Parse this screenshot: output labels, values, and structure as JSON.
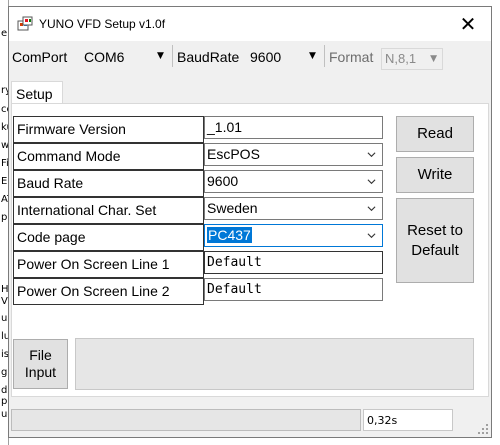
{
  "background_app": {
    "fragments": [
      "e",
      "ry",
      "co",
      "ku",
      "wr",
      "Fi",
      "E",
      "AT",
      "pr",
      "H",
      "V",
      "ul",
      "lu",
      "is",
      "g",
      "du",
      "pi",
      "ud"
    ]
  },
  "window": {
    "title": "YUNO VFD Setup v1.0f",
    "close_glyph": "✕"
  },
  "toolbar": {
    "comport_label": "ComPort",
    "comport_value": "COM6",
    "baudrate_label": "BaudRate",
    "baudrate_value": "9600",
    "format_label": "Format",
    "format_value": "N,8,1"
  },
  "tabs": [
    {
      "label": "Setup",
      "active": true
    }
  ],
  "settings": {
    "firmware_version": {
      "label": "Firmware Version",
      "value": "_1.01"
    },
    "command_mode": {
      "label": "Command Mode",
      "value": "EscPOS"
    },
    "baud_rate": {
      "label": "Baud Rate",
      "value": "9600"
    },
    "intl_char_set": {
      "label": "International Char. Set",
      "value": "Sweden"
    },
    "code_page": {
      "label": "Code page",
      "value": "PC437"
    },
    "power_line_1": {
      "label": "Power On Screen Line 1",
      "value": "Default"
    },
    "power_line_2": {
      "label": "Power On Screen Line 2",
      "value": "Default"
    }
  },
  "buttons": {
    "read": "Read",
    "write": "Write",
    "reset_default": "Reset to Default",
    "file_input": "File Input"
  },
  "status": {
    "time": "0,32s"
  },
  "colors": {
    "selection": "#0078d7",
    "button_face": "#e1e1e1",
    "window_bg": "#f0f0f0"
  }
}
